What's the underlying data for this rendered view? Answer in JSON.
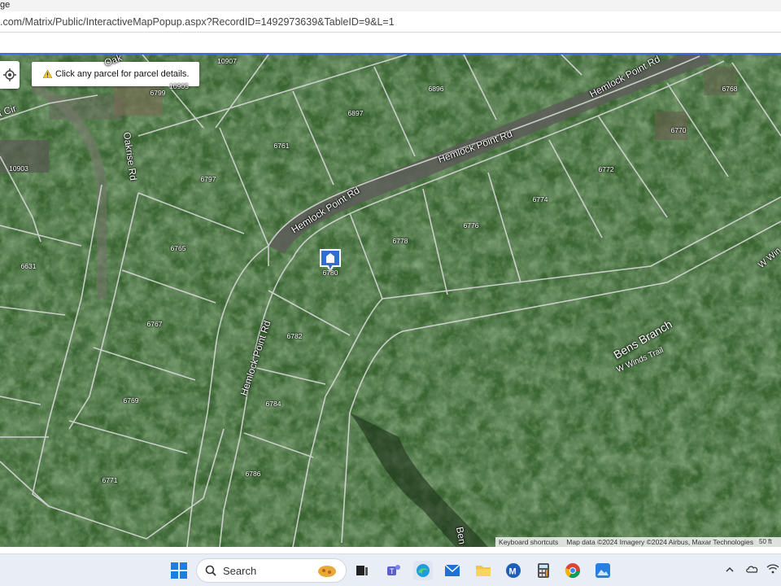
{
  "browser": {
    "tab_fragment": "ge",
    "url": ".com/Matrix/Public/InteractiveMapPopup.aspx?RecordID=1492973639&TableID=9&L=1"
  },
  "map": {
    "notice": "Click any parcel for parcel details.",
    "roads": {
      "hemlock_1": "Hemlock Point Rd",
      "hemlock_2": "Hemlock Point Rd",
      "hemlock_3": "Hemlock Point Rd",
      "hemlock_4": "Hemlock Point Rd",
      "oakrise": "Oakrise Rd",
      "cir": "t Cir",
      "oak_top": "Oak",
      "w_winds": "W Win",
      "ben_bottom": "Ben"
    },
    "areas": {
      "bens_branch": "Bens Branch",
      "w_winds_trail": "W Winds Trail"
    },
    "parcels": {
      "p10907": "10907",
      "p10905": "10905",
      "p6799": "6799",
      "p6896": "6896",
      "p6897": "6897",
      "p6761": "6761",
      "p10903": "10903",
      "p6797": "6797",
      "p6768": "6768",
      "p6770": "6770",
      "p6772": "6772",
      "p6774": "6774",
      "p6776": "6776",
      "p6778": "6778",
      "p6765": "6765",
      "p6631": "6631",
      "p6780": "6780",
      "p6782": "6782",
      "p6767": "6767",
      "p6769": "6769",
      "p6784": "6784",
      "p6786": "6786",
      "p6771": "6771"
    },
    "attribution": {
      "shortcuts": "Keyboard shortcuts",
      "data": "Map data ©2024 Imagery ©2024 Airbus, Maxar Technologies",
      "scale": "50 ft"
    }
  },
  "taskbar": {
    "search_placeholder": "Search"
  },
  "colors": {
    "forest_dark": "#243d21",
    "forest_mid": "#3d6b34",
    "parcel_line": "#d8d8d8",
    "road": "#6b6b6b",
    "map_border": "#3b6fd6",
    "pin": "#2f6fd1"
  }
}
